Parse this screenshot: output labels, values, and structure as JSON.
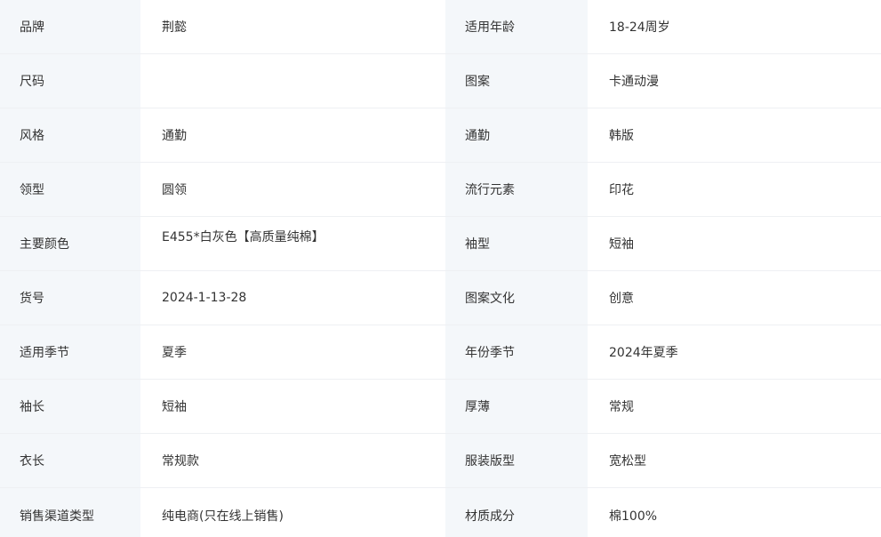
{
  "specs": [
    {
      "l1": "品牌",
      "v1": "荆懿",
      "l2": "适用年龄",
      "v2": "18-24周岁"
    },
    {
      "l1": "尺码",
      "v1": "",
      "l2": "图案",
      "v2": "卡通动漫"
    },
    {
      "l1": "风格",
      "v1": "通勤",
      "l2": "通勤",
      "v2": "韩版"
    },
    {
      "l1": "领型",
      "v1": "圆领",
      "l2": "流行元素",
      "v2": "印花"
    },
    {
      "l1": "主要颜色",
      "v1": "E455*白灰色【高质量纯棉】",
      "l2": "袖型",
      "v2": "短袖"
    },
    {
      "l1": "货号",
      "v1": "2024-1-13-28",
      "l2": "图案文化",
      "v2": "创意"
    },
    {
      "l1": "适用季节",
      "v1": "夏季",
      "l2": "年份季节",
      "v2": "2024年夏季"
    },
    {
      "l1": "袖长",
      "v1": "短袖",
      "l2": "厚薄",
      "v2": "常规"
    },
    {
      "l1": "衣长",
      "v1": "常规款",
      "l2": "服装版型",
      "v2": "宽松型"
    },
    {
      "l1": "销售渠道类型",
      "v1": "纯电商(只在线上销售)",
      "l2": "材质成分",
      "v2": "棉100%"
    }
  ]
}
